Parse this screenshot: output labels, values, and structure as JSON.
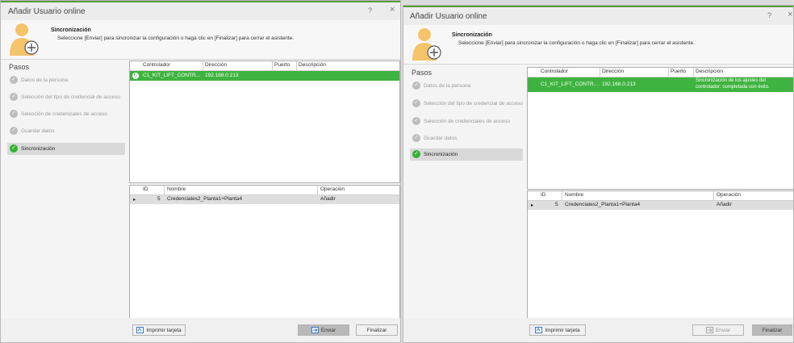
{
  "window": {
    "title": "Añadir Usuario online",
    "help": "?",
    "close": "×"
  },
  "header": {
    "title": "Sincronización",
    "description": "Seleccione [Enviar] para sincronizar la configuración o haga clic en [Finalizar] para cerrar el asistente."
  },
  "steps": {
    "title": "Pasos",
    "items": [
      {
        "label": "Datos de la persona"
      },
      {
        "label": "Selección del tipo de credencial de acceso"
      },
      {
        "label": "Selección de credenciales de acceso"
      },
      {
        "label": "Guardar datos"
      },
      {
        "label": "Sincronización"
      }
    ]
  },
  "controllers": {
    "columns": [
      "Controlador",
      "Dirección",
      "Puerto",
      "Descripción"
    ],
    "row_left": {
      "controller": "C1_KIT_LIFT_CONTR...",
      "address": "192.168.0.213",
      "port": "",
      "description": ""
    },
    "row_right": {
      "controller": "C1_KIT_LIFT_CONTR...",
      "address": "192.168.0.213",
      "port": "",
      "description_line1": "Sincronización de los ajustes del",
      "description_line2": "controlador: completada con éxito."
    }
  },
  "credentials": {
    "columns": [
      "ID",
      "Nombre",
      "Operación"
    ],
    "row": {
      "arrow": "▸",
      "id": "5",
      "name": "Credenciales2_Planta1+Planta4",
      "operation": "Añadir"
    }
  },
  "buttons": {
    "print": "Imprimir tarjeta",
    "send": "Enviar",
    "finish": "Finalizar"
  },
  "colors": {
    "accent_green": "#3fb33f",
    "check_green": "#33b233"
  }
}
